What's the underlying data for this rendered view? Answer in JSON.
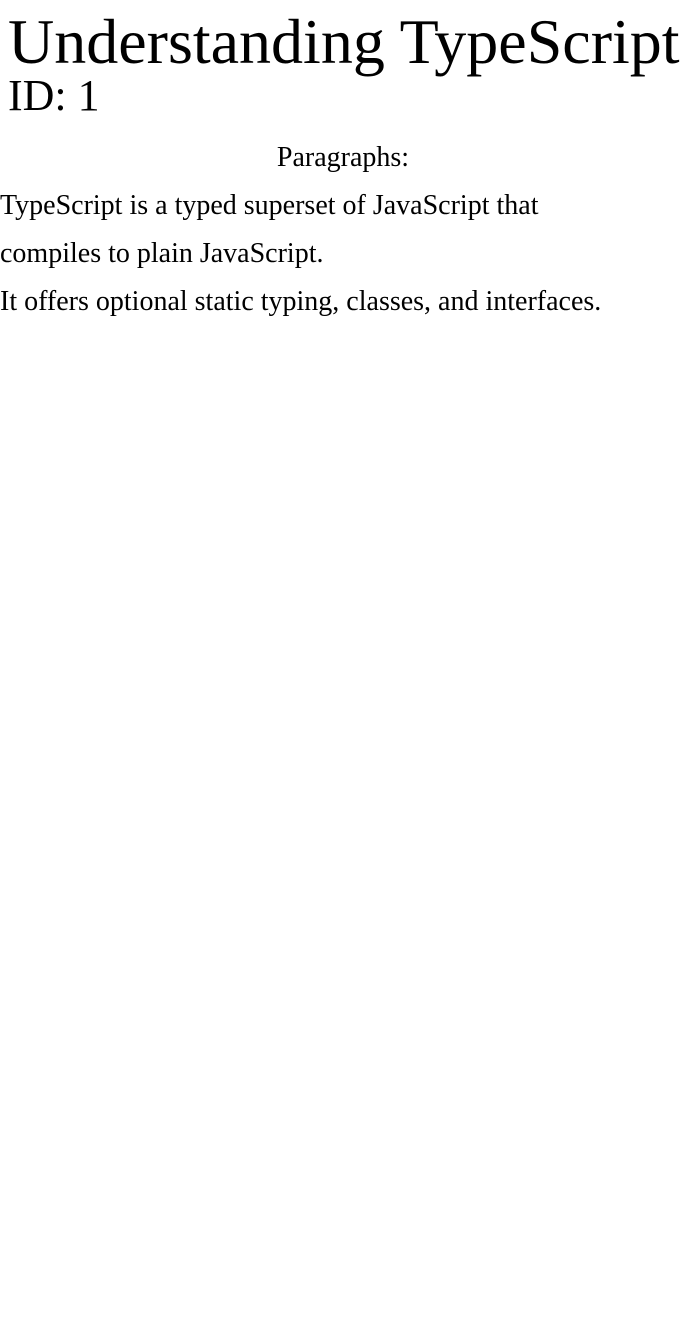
{
  "document": {
    "title": "Understanding TypeScript",
    "id_text": "ID: 1",
    "paragraphs_heading": "Paragraphs:",
    "paragraphs": [
      "TypeScript is a typed superset of JavaScript that compiles to plain JavaScript.",
      "It offers optional static typing, classes, and interfaces."
    ]
  }
}
